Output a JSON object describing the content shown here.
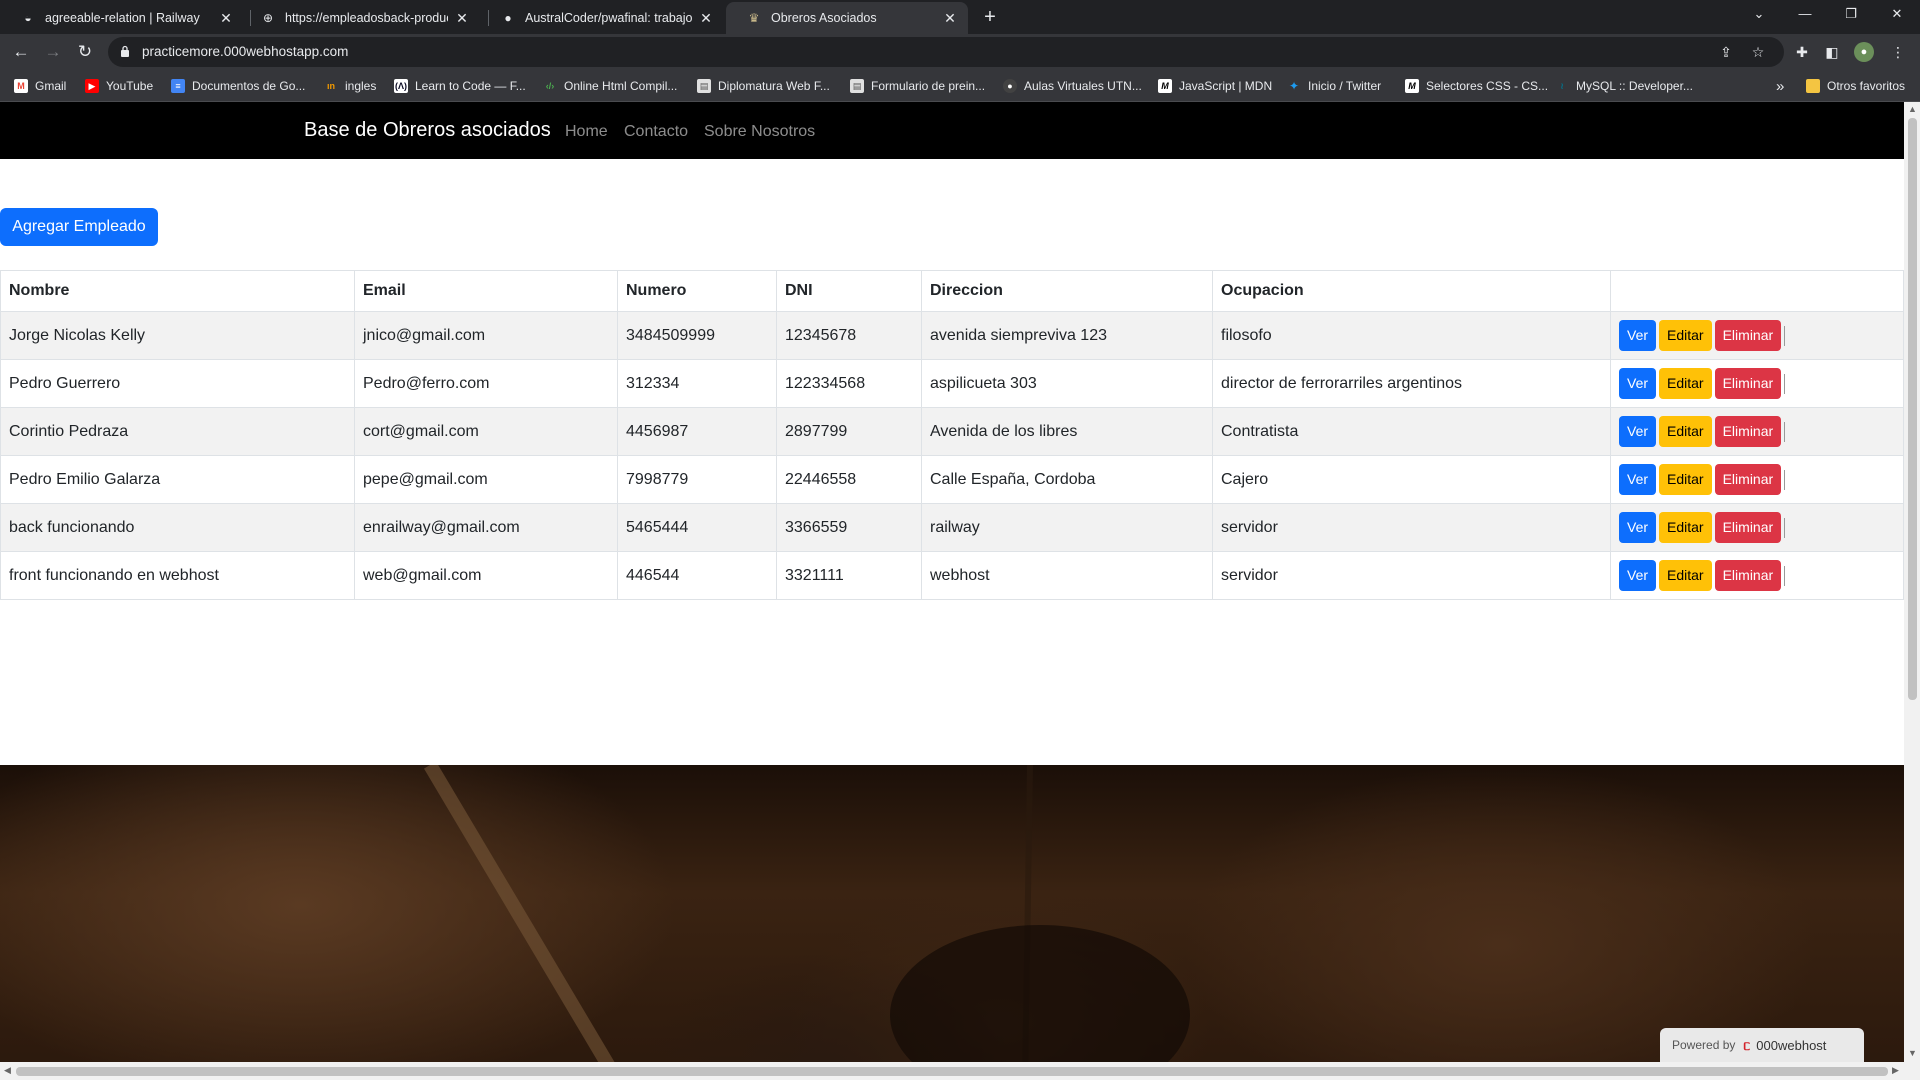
{
  "browser": {
    "tabs": [
      {
        "title": "agreeable-relation | Railway",
        "icon": "railway-icon",
        "active": false
      },
      {
        "title": "https://empleadosback-producti",
        "icon": "globe-icon",
        "active": false
      },
      {
        "title": "AustralCoder/pwafinal: trabajo fi",
        "icon": "github-icon",
        "active": false
      },
      {
        "title": "Obreros Asociados",
        "icon": "web-favicon",
        "active": true
      }
    ],
    "new_tab": "+",
    "address": "practicemore.000webhostapp.com",
    "bookmarks": [
      {
        "label": "Gmail",
        "icon": "gmail-icon",
        "color": "#ea4335"
      },
      {
        "label": "YouTube",
        "icon": "youtube-icon",
        "color": "#ff0000"
      },
      {
        "label": "Documentos de Go...",
        "icon": "docs-icon",
        "color": "#4285f4"
      },
      {
        "label": "ingles",
        "icon": "ingles-icon",
        "color": "#f29900"
      },
      {
        "label": "Learn to Code — F...",
        "icon": "freecodecamp-icon",
        "color": "#0a0a23"
      },
      {
        "label": "Online Html Compil...",
        "icon": "code-icon",
        "color": "#2e7d32"
      },
      {
        "label": "Diplomatura Web F...",
        "icon": "page-icon",
        "color": "#9e9e9e"
      },
      {
        "label": "Formulario de prein...",
        "icon": "page-icon",
        "color": "#9e9e9e"
      },
      {
        "label": "Aulas Virtuales UTN...",
        "icon": "utn-icon",
        "color": "#424242"
      },
      {
        "label": "JavaScript | MDN",
        "icon": "mdn-icon",
        "color": "#000000"
      },
      {
        "label": "Inicio / Twitter",
        "icon": "twitter-icon",
        "color": "#1d9bf0"
      },
      {
        "label": "Selectores CSS - CS...",
        "icon": "mdn-icon",
        "color": "#000000"
      },
      {
        "label": "MySQL :: Developer...",
        "icon": "mysql-icon",
        "color": "#00758f"
      }
    ],
    "other_bookmarks": "Otros favoritos",
    "overflow": "»"
  },
  "site": {
    "brand": "Base de Obreros asociados",
    "nav": [
      "Home",
      "Contacto",
      "Sobre Nosotros"
    ],
    "add_button": "Agregar Empleado",
    "columns": [
      "Nombre",
      "Email",
      "Numero",
      "DNI",
      "Direccion",
      "Ocupacion",
      ""
    ],
    "rows": [
      {
        "nombre": "Jorge Nicolas Kelly",
        "email": "jnico@gmail.com",
        "numero": "3484509999",
        "dni": "12345678",
        "direccion": "avenida siempreviva 123",
        "ocupacion": "filosofo"
      },
      {
        "nombre": "Pedro Guerrero",
        "email": "Pedro@ferro.com",
        "numero": "312334",
        "dni": "122334568",
        "direccion": "aspilicueta 303",
        "ocupacion": "director de ferrorarriles argentinos"
      },
      {
        "nombre": "Corintio Pedraza",
        "email": "cort@gmail.com",
        "numero": "4456987",
        "dni": "2897799",
        "direccion": "Avenida de los libres",
        "ocupacion": "Contratista"
      },
      {
        "nombre": "Pedro Emilio Galarza",
        "email": "pepe@gmail.com",
        "numero": "7998779",
        "dni": "22446558",
        "direccion": "Calle España, Cordoba",
        "ocupacion": "Cajero"
      },
      {
        "nombre": "back funcionando",
        "email": "enrailway@gmail.com",
        "numero": "5465444",
        "dni": "3366559",
        "direccion": "railway",
        "ocupacion": "servidor"
      },
      {
        "nombre": "front funcionando en webhost",
        "email": "web@gmail.com",
        "numero": "446544",
        "dni": "3321111",
        "direccion": "webhost",
        "ocupacion": "servidor"
      }
    ],
    "actions": {
      "view": "Ver",
      "edit": "Editar",
      "delete": "Eliminar"
    },
    "powered_by": "Powered by",
    "powered_brand": "000webhost"
  },
  "colors": {
    "primary": "#0d6efd",
    "warning": "#ffc107",
    "danger": "#dc3545",
    "navbar": "#000000"
  }
}
